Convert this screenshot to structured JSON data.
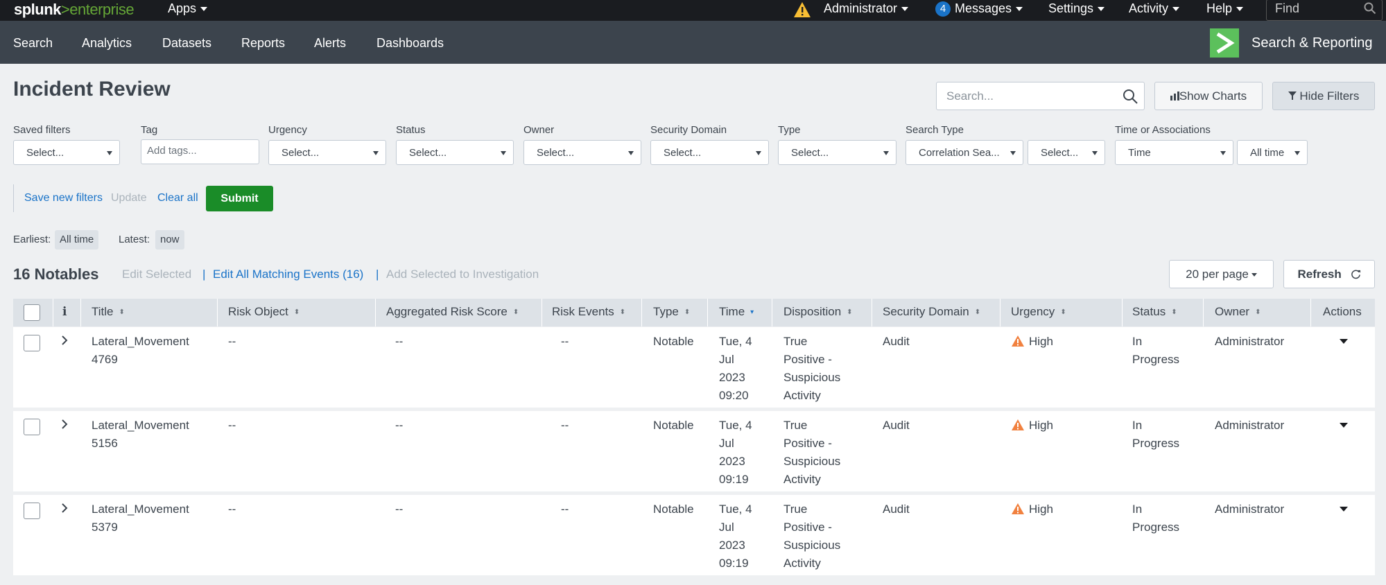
{
  "topbar": {
    "logo_splunk": "splunk",
    "logo_gt": ">",
    "logo_enterprise": "enterprise",
    "apps": "Apps",
    "administrator": "Administrator",
    "messages_count": "4",
    "messages": "Messages",
    "settings": "Settings",
    "activity": "Activity",
    "help": "Help",
    "find_placeholder": "Find"
  },
  "appbar": {
    "nav": [
      "Search",
      "Analytics",
      "Datasets",
      "Reports",
      "Alerts",
      "Dashboards"
    ],
    "app_title": "Search & Reporting"
  },
  "header": {
    "title": "Incident Review",
    "search_placeholder": "Search...",
    "show_charts": "Show Charts",
    "hide_filters": "Hide Filters"
  },
  "filters": {
    "saved_filters": {
      "label": "Saved filters",
      "value": "Select..."
    },
    "tag": {
      "label": "Tag",
      "placeholder": "Add tags..."
    },
    "urgency": {
      "label": "Urgency",
      "value": "Select..."
    },
    "status": {
      "label": "Status",
      "value": "Select..."
    },
    "owner": {
      "label": "Owner",
      "value": "Select..."
    },
    "security_domain": {
      "label": "Security Domain",
      "value": "Select..."
    },
    "type": {
      "label": "Type",
      "value": "Select..."
    },
    "search_type": {
      "label": "Search Type",
      "value": "Correlation Sea...",
      "value2": "Select..."
    },
    "time_assoc": {
      "label": "Time or Associations",
      "value": "Time",
      "value2": "All time"
    }
  },
  "filter_actions": {
    "save_new": "Save new filters",
    "update": "Update",
    "clear_all": "Clear all",
    "submit": "Submit"
  },
  "range": {
    "earliest_label": "Earliest:",
    "earliest_value": "All time",
    "latest_label": "Latest:",
    "latest_value": "now"
  },
  "notables": {
    "count_label": "16 Notables",
    "edit_selected": "Edit Selected",
    "edit_all": "Edit All Matching Events (16)",
    "add_to_investigation": "Add Selected to Investigation",
    "separator": "|",
    "per_page": "20 per page",
    "refresh": "Refresh"
  },
  "table": {
    "info_header": "i",
    "columns": {
      "title": "Title",
      "risk_object": "Risk Object",
      "agg_risk": "Aggregated Risk Score",
      "risk_events": "Risk Events",
      "type": "Type",
      "time": "Time",
      "disposition": "Disposition",
      "security_domain": "Security Domain",
      "urgency": "Urgency",
      "status": "Status",
      "owner": "Owner",
      "actions": "Actions"
    },
    "rows": [
      {
        "title1": "Lateral_Movement",
        "title2": "4769",
        "risk_object": "--",
        "agg_risk": "--",
        "risk_events": "--",
        "type": "Notable",
        "time1": "Tue, 4",
        "time2": "Jul",
        "time3": "2023",
        "time4": "09:20",
        "disp1": "True",
        "disp2": "Positive -",
        "disp3": "Suspicious",
        "disp4": "Activity",
        "domain": "Audit",
        "urgency": "High",
        "status1": "In",
        "status2": "Progress",
        "owner": "Administrator"
      },
      {
        "title1": "Lateral_Movement",
        "title2": "5156",
        "risk_object": "--",
        "agg_risk": "--",
        "risk_events": "--",
        "type": "Notable",
        "time1": "Tue, 4",
        "time2": "Jul",
        "time3": "2023",
        "time4": "09:19",
        "disp1": "True",
        "disp2": "Positive -",
        "disp3": "Suspicious",
        "disp4": "Activity",
        "domain": "Audit",
        "urgency": "High",
        "status1": "In",
        "status2": "Progress",
        "owner": "Administrator"
      },
      {
        "title1": "Lateral_Movement",
        "title2": "5379",
        "risk_object": "--",
        "agg_risk": "--",
        "risk_events": "--",
        "type": "Notable",
        "time1": "Tue, 4",
        "time2": "Jul",
        "time3": "2023",
        "time4": "09:19",
        "disp1": "True",
        "disp2": "Positive -",
        "disp3": "Suspicious",
        "disp4": "Activity",
        "domain": "Audit",
        "urgency": "High",
        "status1": "In",
        "status2": "Progress",
        "owner": "Administrator"
      }
    ]
  },
  "colors": {
    "topbar_bg": "#1a1c20",
    "appbar_bg": "#3c444d",
    "brand_green": "#65a637",
    "submit_green": "#1a8c28",
    "link_blue": "#1a73c8",
    "urgency_high": "#f1813f"
  }
}
